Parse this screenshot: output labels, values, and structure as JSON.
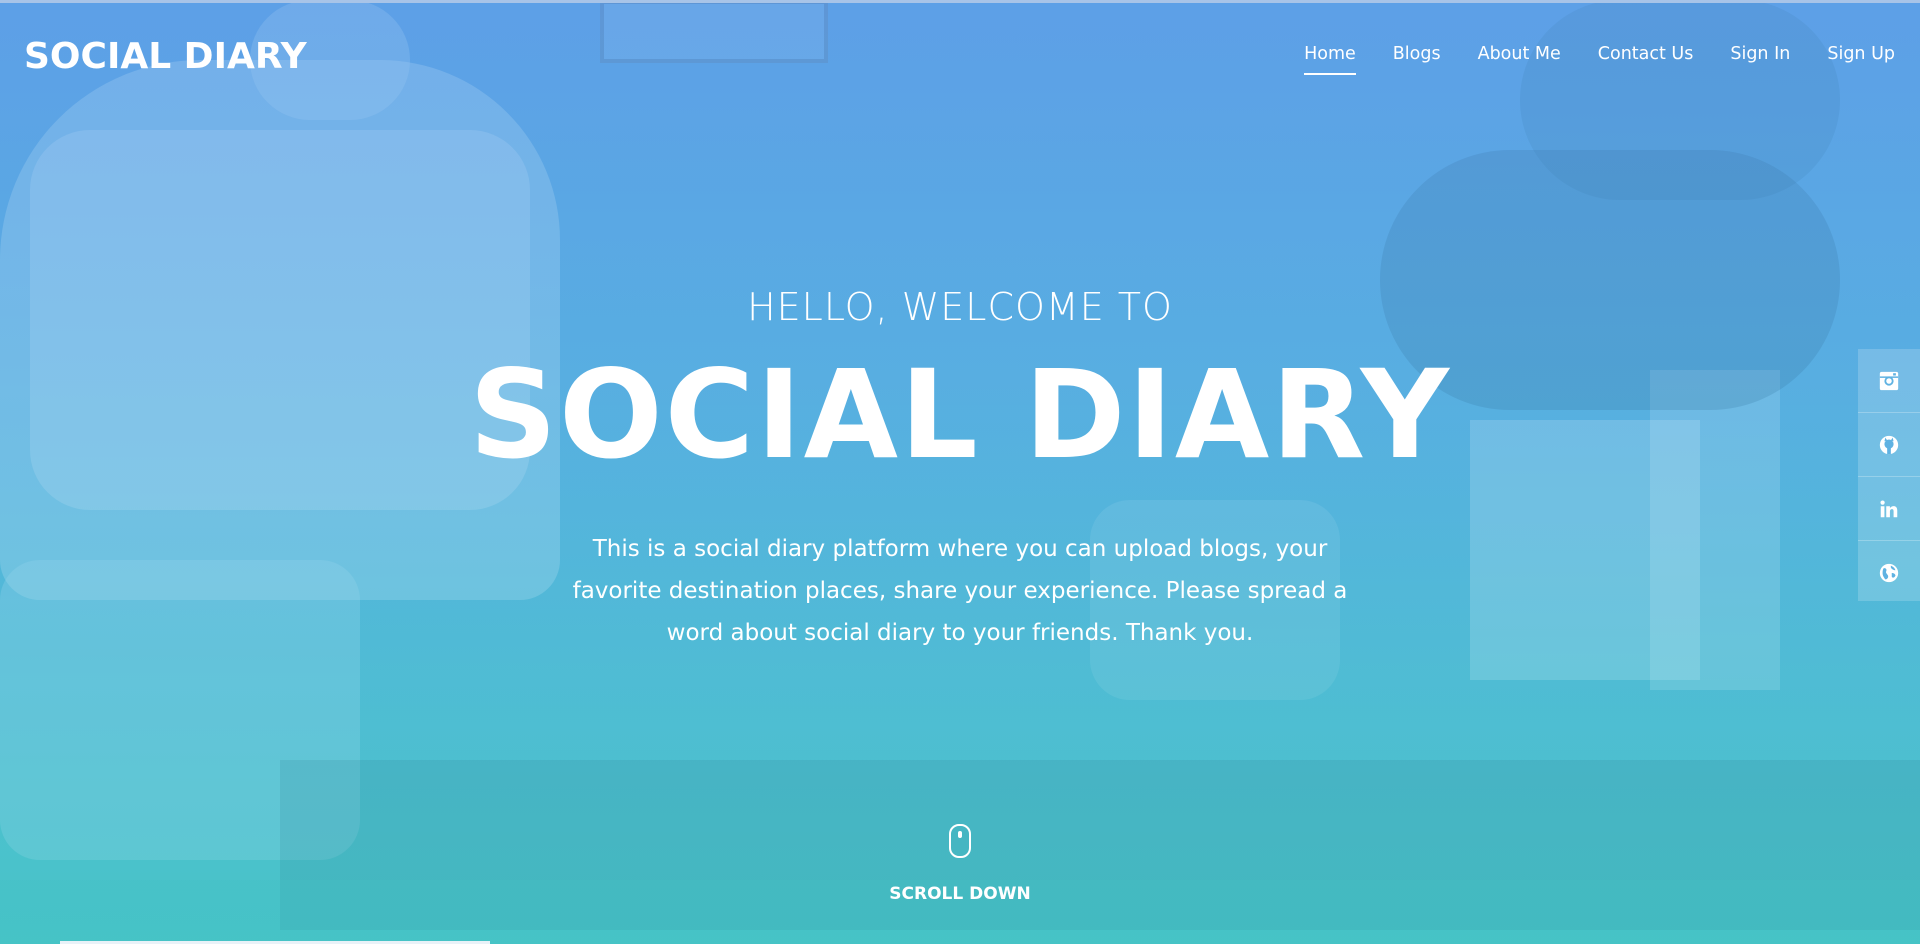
{
  "brand": "SOCIAL DIARY",
  "nav": {
    "items": [
      {
        "label": "Home",
        "active": true
      },
      {
        "label": "Blogs",
        "active": false
      },
      {
        "label": "About Me",
        "active": false
      },
      {
        "label": "Contact Us",
        "active": false
      },
      {
        "label": "Sign In",
        "active": false
      },
      {
        "label": "Sign Up",
        "active": false
      }
    ]
  },
  "hero": {
    "welcome": "HELLO, WELCOME TO",
    "title": "SOCIAL DIARY",
    "description": "This is a social diary platform where you can upload blogs, your favorite destination places, share your experience. Please spread a word about social diary to your friends. Thank you."
  },
  "scroll": {
    "label": "SCROLL DOWN",
    "icon": "mouse-icon"
  },
  "social": {
    "icons": [
      "instagram-icon",
      "github-icon",
      "linkedin-icon",
      "globe-icon"
    ]
  },
  "colors": {
    "gradient_top": "#5b9fe6",
    "gradient_bottom": "#48c4c7",
    "text": "#ffffff"
  }
}
